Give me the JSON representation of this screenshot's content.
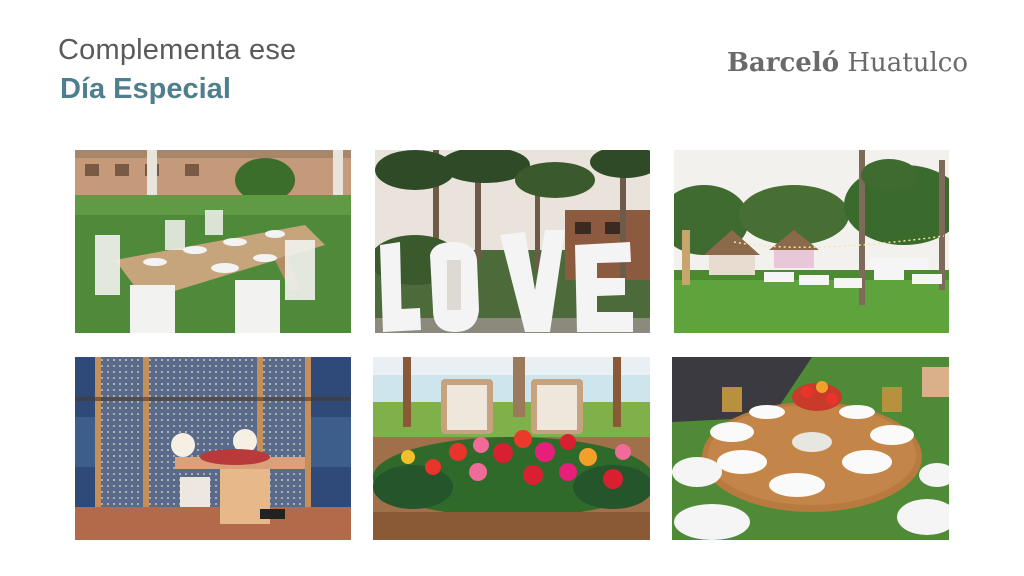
{
  "header": {
    "title_line1": "Complementa ese",
    "title_line2": "Día Especial"
  },
  "brand": {
    "name_bold": "Barceló",
    "name_regular": "Huatulco"
  },
  "gallery": {
    "photos": [
      {
        "subject": "outdoor-long-table-with-white-chairs"
      },
      {
        "subject": "giant-love-letters-under-palms"
      },
      {
        "subject": "garden-reception-with-palapas-and-string-lights"
      },
      {
        "subject": "curtain-of-lights-sweetheart-table-at-dusk"
      },
      {
        "subject": "floral-centerpiece-head-table"
      },
      {
        "subject": "round-table-setting-with-roses"
      }
    ]
  },
  "colors": {
    "title_accent": "#4f7e8d",
    "title_gray": "#5a5a5a",
    "brand_gray": "#6a6a6a"
  }
}
